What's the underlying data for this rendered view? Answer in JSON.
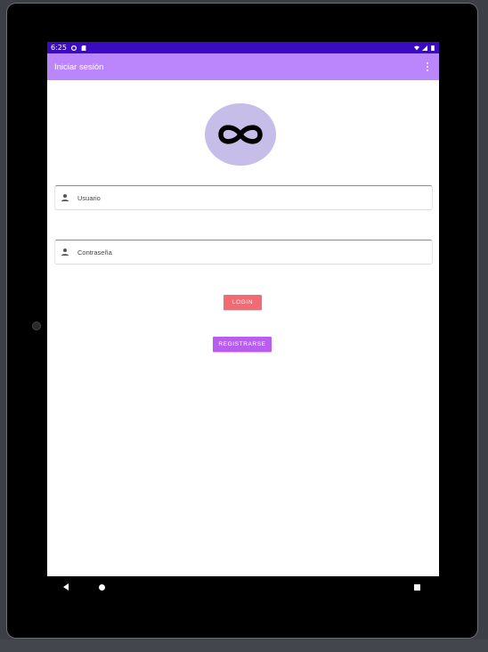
{
  "status_bar": {
    "time": "6:25",
    "icons_left": [
      "data-saver-icon",
      "sd-card-icon"
    ],
    "icons_right": [
      "wifi-icon",
      "signal-icon",
      "battery-icon"
    ]
  },
  "app_bar": {
    "title": "Iniciar sesión",
    "menu_icon": "more-vert-icon"
  },
  "logo": {
    "icon": "infinity-icon",
    "background": "#c7bde9"
  },
  "form": {
    "username": {
      "placeholder": "Usuario",
      "value": "",
      "icon": "person-icon"
    },
    "password": {
      "placeholder": "Contraseña",
      "value": "",
      "icon": "person-icon"
    }
  },
  "buttons": {
    "login_label": "LOGIN",
    "register_label": "REGISTRARSE"
  },
  "colors": {
    "status_bar": "#3b0bbf",
    "app_bar": "#bb86fc",
    "login_button": "#f26a73",
    "register_button": "#b95df0"
  },
  "nav_bar": {
    "icons": [
      "back-icon",
      "home-icon",
      "recents-icon"
    ]
  }
}
